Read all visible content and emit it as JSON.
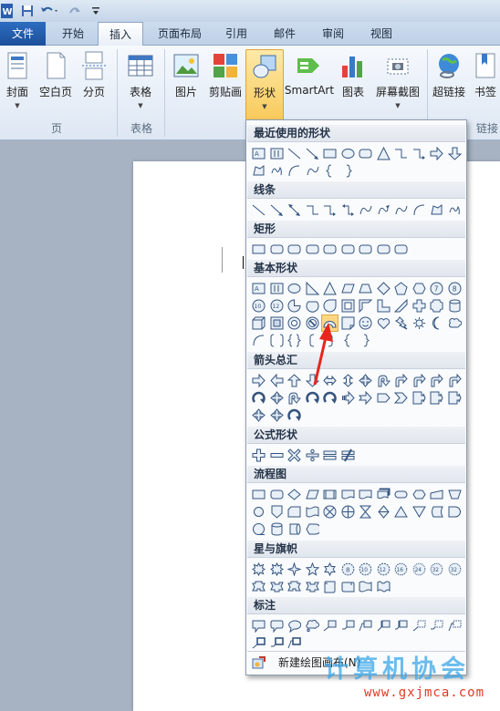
{
  "quick_access": {
    "app_icon": "word-icon",
    "save_icon": "save-icon",
    "undo_icon": "undo-icon",
    "redo_icon": "redo-icon",
    "dropdown_icon": "customize-icon"
  },
  "tabs": [
    {
      "label": "文件"
    },
    {
      "label": "开始"
    },
    {
      "label": "插入"
    },
    {
      "label": "页面布局"
    },
    {
      "label": "引用"
    },
    {
      "label": "邮件"
    },
    {
      "label": "审阅"
    },
    {
      "label": "视图"
    }
  ],
  "ribbon": {
    "buttons": [
      {
        "label": "封面",
        "icon": "cover-page-icon"
      },
      {
        "label": "空白页",
        "icon": "blank-page-icon"
      },
      {
        "label": "分页",
        "icon": "page-break-icon"
      },
      {
        "label": "表格",
        "icon": "table-icon"
      },
      {
        "label": "图片",
        "icon": "picture-icon"
      },
      {
        "label": "剪贴画",
        "icon": "clip-art-icon"
      },
      {
        "label": "形状",
        "icon": "shapes-icon"
      },
      {
        "label": "SmartArt",
        "icon": "smartart-icon"
      },
      {
        "label": "图表",
        "icon": "chart-icon"
      },
      {
        "label": "屏幕截图",
        "icon": "screenshot-icon"
      },
      {
        "label": "超链接",
        "icon": "hyperlink-icon"
      },
      {
        "label": "书签",
        "icon": "bookmark-icon"
      }
    ],
    "groups": [
      {
        "label": "页"
      },
      {
        "label": "表格"
      },
      {
        "label": "链接"
      }
    ]
  },
  "shapes_menu": {
    "categories": [
      {
        "label": "最近使用的形状"
      },
      {
        "label": "线条"
      },
      {
        "label": "矩形"
      },
      {
        "label": "基本形状"
      },
      {
        "label": "箭头总汇"
      },
      {
        "label": "公式形状"
      },
      {
        "label": "流程图"
      },
      {
        "label": "星与旗帜"
      },
      {
        "label": "标注"
      }
    ],
    "new_canvas_label": "新建绘图画布(N)"
  },
  "watermark": {
    "line1": "计算机协会",
    "line2": "www.gxjmca.com"
  },
  "colors": {
    "accent": "#2d6cc0",
    "selected": "#f8c95a",
    "arrow": "#e8251e"
  }
}
